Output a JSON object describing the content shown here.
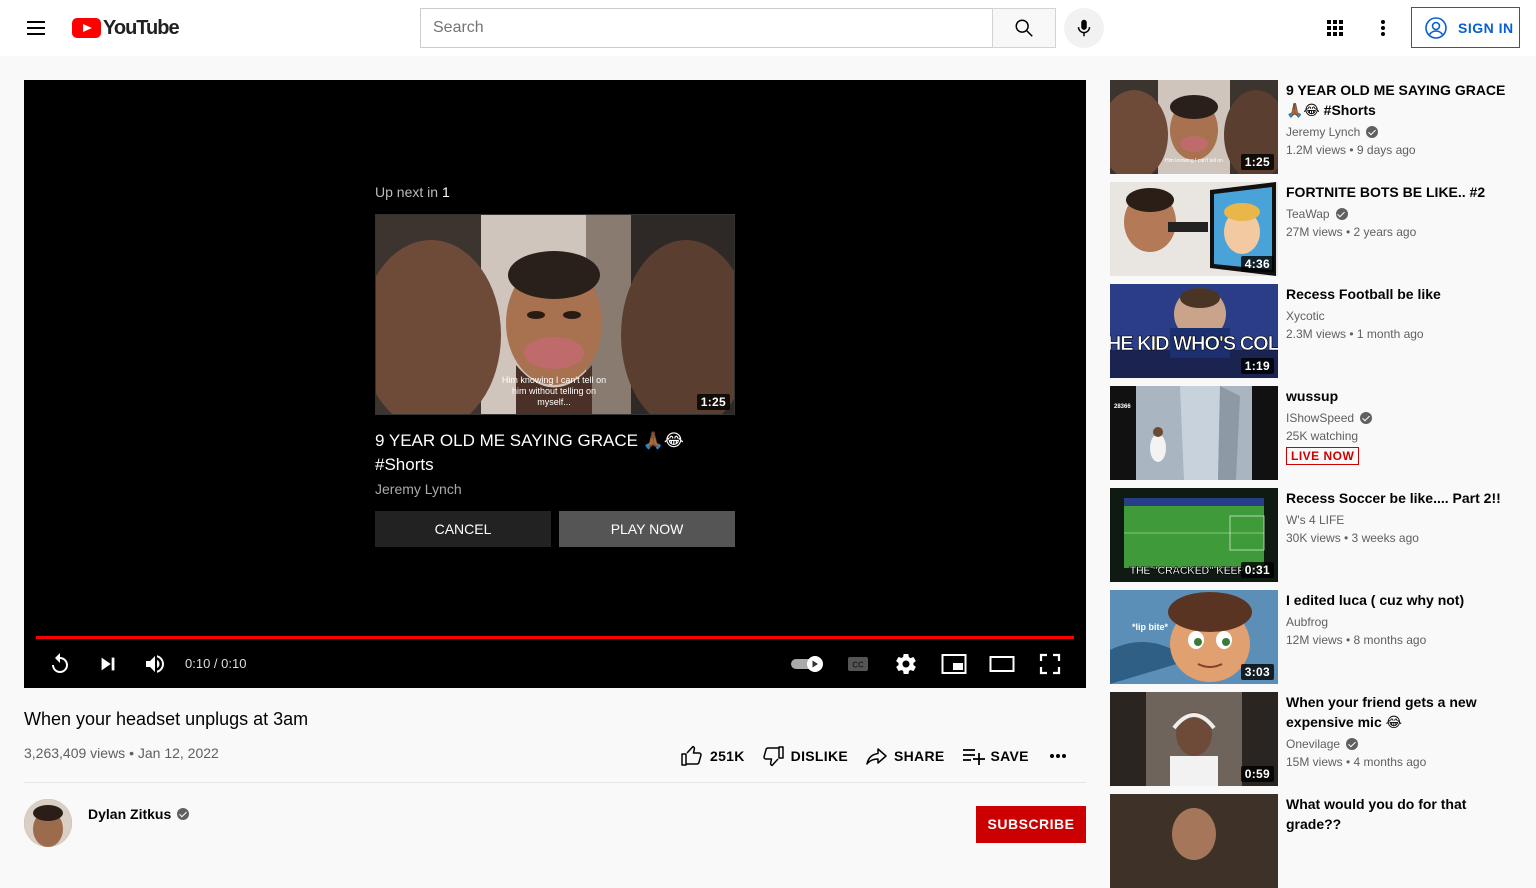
{
  "header": {
    "logo_text": "YouTube",
    "search_placeholder": "Search",
    "signin_label": "SIGN IN"
  },
  "player": {
    "upnext_label": "Up next in",
    "upnext_count": "1",
    "upnext_title": "9 YEAR OLD ME SAYING GRACE 🙏🏾😂 #Shorts",
    "upnext_channel": "Jeremy Lynch",
    "upnext_duration": "1:25",
    "upnext_caption": "Him knowing I can't tell on him without telling on myself...",
    "cancel_label": "CANCEL",
    "playnow_label": "PLAY NOW",
    "time": "0:10 / 0:10",
    "progress": 1.0
  },
  "video": {
    "title": "When your headset unplugs at 3am",
    "meta": "3,263,409 views • Jan 12, 2022",
    "likes": "251K",
    "dislike_label": "DISLIKE",
    "share_label": "SHARE",
    "save_label": "SAVE",
    "owner_name": "Dylan Zitkus",
    "subscribe_label": "SUBSCRIBE"
  },
  "recommendations": [
    {
      "title": "9 YEAR OLD ME SAYING GRACE 🙏🏾😂 #Shorts",
      "channel": "Jeremy Lynch",
      "verified": true,
      "stats": "1.2M views • 9 days ago",
      "duration": "1:25",
      "theme": "face"
    },
    {
      "title": "FORTNITE BOTS BE LIKE.. #2",
      "channel": "TeaWap",
      "verified": true,
      "stats": "27M views • 2 years ago",
      "duration": "4:36",
      "theme": "fortnite"
    },
    {
      "title": "Recess Football be like",
      "channel": "Xycotic",
      "verified": false,
      "stats": "2.3M views • 1 month ago",
      "duration": "1:19",
      "theme": "football",
      "caption": "THE KID WHO'S COLD"
    },
    {
      "title": "wussup",
      "channel": "IShowSpeed",
      "verified": true,
      "stats": "25K watching",
      "live": "LIVE NOW",
      "theme": "live"
    },
    {
      "title": "Recess Soccer be like.... Part 2!!",
      "channel": "W's 4 LIFE",
      "verified": false,
      "stats": "30K views • 3 weeks ago",
      "duration": "0:31",
      "theme": "soccer",
      "caption": "THE \"CRACKED\" KEEPER"
    },
    {
      "title": "I edited luca ( cuz why not)",
      "channel": "Aubfrog",
      "verified": false,
      "stats": "12M views • 8 months ago",
      "duration": "3:03",
      "theme": "luca",
      "caption": "*lip bite*"
    },
    {
      "title": "When your friend gets a new expensive mic 😂",
      "channel": "Onevilage",
      "verified": true,
      "stats": "15M views • 4 months ago",
      "duration": "0:59",
      "theme": "mic"
    },
    {
      "title": "What would you do for that grade??",
      "channel": "",
      "verified": false,
      "stats": "",
      "theme": "grade"
    }
  ]
}
